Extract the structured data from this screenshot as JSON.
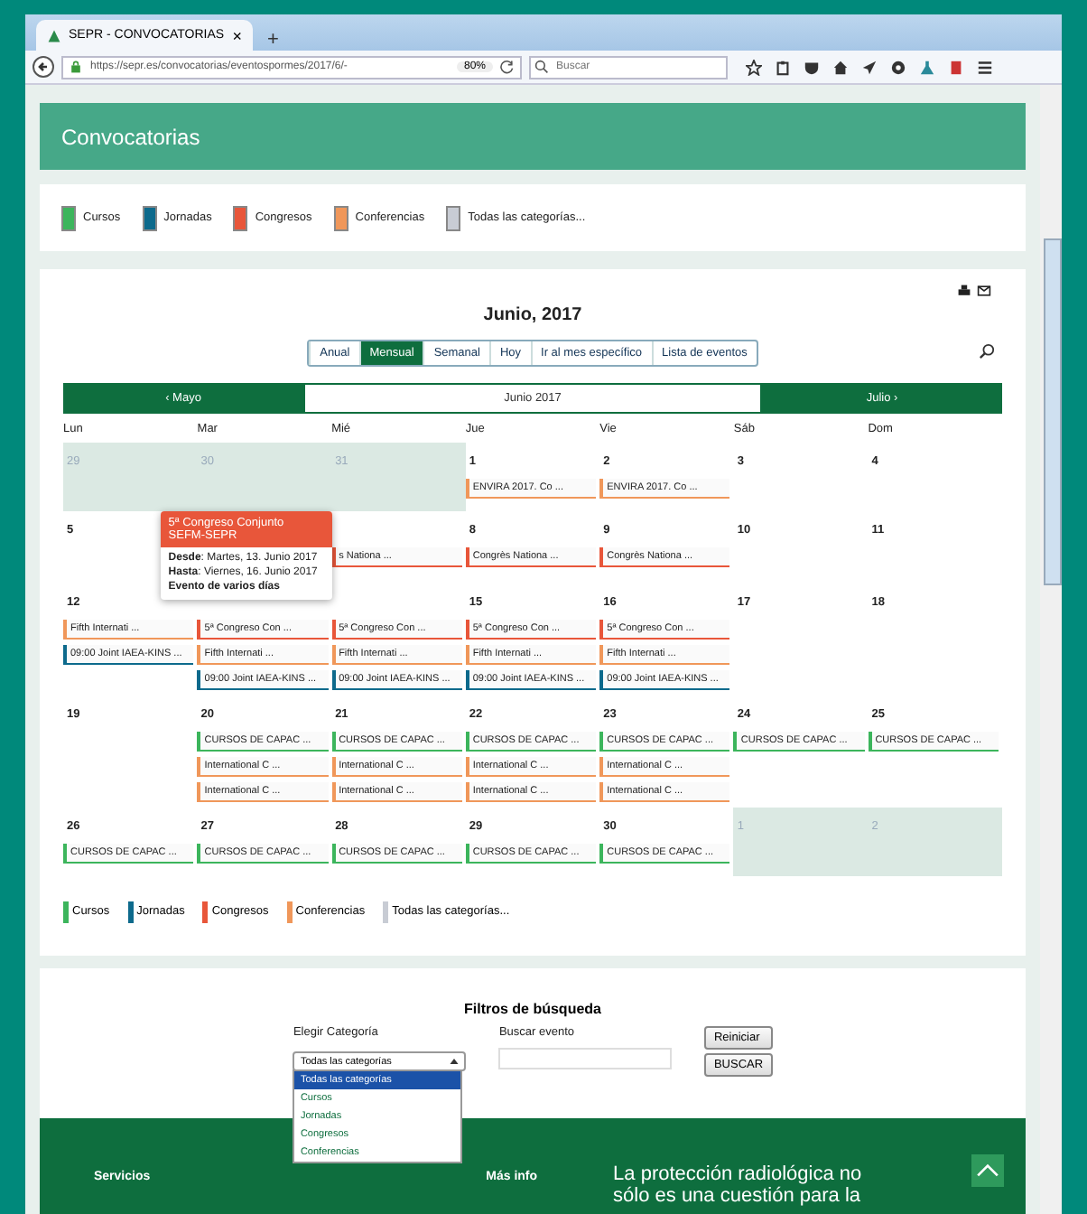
{
  "browser": {
    "tab_title": "SEPR - CONVOCATORIAS",
    "tab_close": "×",
    "new_tab": "+",
    "url": "https://sepr.es/convocatorias/eventospormes/2017/6/-",
    "zoom": "80%",
    "search_placeholder": "Buscar"
  },
  "header": {
    "title": "Convocatorias"
  },
  "legend_top": [
    {
      "label": "Cursos",
      "color": "#3cb55c"
    },
    {
      "label": "Jornadas",
      "color": "#0d6a8c"
    },
    {
      "label": "Congresos",
      "color": "#e8563a"
    },
    {
      "label": "Conferencias",
      "color": "#f0975a"
    },
    {
      "label": "Todas las categorías...",
      "color": "#c8ccd4"
    }
  ],
  "calendar": {
    "title": "Junio, 2017",
    "views": [
      {
        "label": "Anual",
        "selected": false
      },
      {
        "label": "Mensual",
        "selected": true
      },
      {
        "label": "Semanal",
        "selected": false
      },
      {
        "label": "Hoy",
        "selected": false
      },
      {
        "label": "Ir al mes específico",
        "selected": false
      },
      {
        "label": "Lista de eventos",
        "selected": false
      }
    ],
    "nav": {
      "prev": "‹ Mayo",
      "current": "Junio 2017",
      "next": "Julio ›"
    },
    "weekdays": [
      "Lun",
      "Mar",
      "Mié",
      "Jue",
      "Vie",
      "Sáb",
      "Dom"
    ],
    "weeks": [
      {
        "days": [
          {
            "day": "29",
            "other_month": true
          },
          {
            "day": "30",
            "other_month": true
          },
          {
            "day": "31",
            "other_month": true
          },
          {
            "day": "1",
            "other_month": false,
            "events": [
              {
                "text": "ENVIRA 2017. Co ...",
                "color": "#f0975a"
              }
            ]
          },
          {
            "day": "2",
            "other_month": false,
            "events": [
              {
                "text": "ENVIRA 2017. Co ...",
                "color": "#f0975a"
              }
            ]
          },
          {
            "day": "3",
            "other_month": false
          },
          {
            "day": "4",
            "other_month": false
          }
        ]
      },
      {
        "days": [
          {
            "day": "5",
            "other_month": false
          },
          {
            "popup": {
              "title": "5ª Congreso Conjunto SEFM-SEPR",
              "lines": [
                "**Desde**: Martes, 13. Junio 2017",
                "**Hasta**: Viernes, 16. Junio 2017"
              ],
              "note": "Evento de varios días"
            }
          },
          {
            "other_month": false,
            "events": [
              {
                "text": "s Nationa ...",
                "color": "#e8563a"
              }
            ]
          },
          {
            "day": "8",
            "other_month": false,
            "events": [
              {
                "text": "Congrès Nationa ...",
                "color": "#e8563a"
              }
            ]
          },
          {
            "day": "9",
            "other_month": false,
            "events": [
              {
                "text": "Congrès Nationa ...",
                "color": "#e8563a"
              }
            ]
          },
          {
            "day": "10",
            "other_month": false
          },
          {
            "day": "11",
            "other_month": false
          }
        ]
      },
      {
        "days": [
          {
            "day": "12",
            "other_month": false,
            "events": [
              {
                "text": "Fifth Internati ...",
                "color": "#f0975a"
              },
              {
                "text": "09:00 Joint IAEA-KINS ...",
                "color": "#0d6a8c"
              }
            ]
          },
          {
            "other_month": false,
            "events": [
              {
                "text": "5ª Congreso Con ...",
                "color": "#e8563a"
              },
              {
                "text": "Fifth Internati ...",
                "color": "#f0975a"
              },
              {
                "text": "09:00 Joint IAEA-KINS ...",
                "color": "#0d6a8c"
              }
            ]
          },
          {
            "other_month": false,
            "events": [
              {
                "text": "5ª Congreso Con ...",
                "color": "#e8563a"
              },
              {
                "text": "Fifth Internati ...",
                "color": "#f0975a"
              },
              {
                "text": "09:00 Joint IAEA-KINS ...",
                "color": "#0d6a8c"
              }
            ]
          },
          {
            "day": "15",
            "other_month": false,
            "events": [
              {
                "text": "5ª Congreso Con ...",
                "color": "#e8563a"
              },
              {
                "text": "Fifth Internati ...",
                "color": "#f0975a"
              },
              {
                "text": "09:00 Joint IAEA-KINS ...",
                "color": "#0d6a8c"
              }
            ]
          },
          {
            "day": "16",
            "other_month": false,
            "events": [
              {
                "text": "5ª Congreso Con ...",
                "color": "#e8563a"
              },
              {
                "text": "Fifth Internati ...",
                "color": "#f0975a"
              },
              {
                "text": "09:00 Joint IAEA-KINS ...",
                "color": "#0d6a8c"
              }
            ]
          },
          {
            "day": "17",
            "other_month": false
          },
          {
            "day": "18",
            "other_month": false
          }
        ]
      },
      {
        "days": [
          {
            "day": "19",
            "other_month": false
          },
          {
            "day": "20",
            "other_month": false,
            "events": [
              {
                "text": "CURSOS DE CAPAC ...",
                "color": "#3cb55c"
              },
              {
                "text": "International C ...",
                "color": "#f0975a"
              },
              {
                "text": "International C ...",
                "color": "#f0975a"
              }
            ]
          },
          {
            "day": "21",
            "other_month": false,
            "events": [
              {
                "text": "CURSOS DE CAPAC ...",
                "color": "#3cb55c"
              },
              {
                "text": "International C ...",
                "color": "#f0975a"
              },
              {
                "text": "International C ...",
                "color": "#f0975a"
              }
            ]
          },
          {
            "day": "22",
            "other_month": false,
            "events": [
              {
                "text": "CURSOS DE CAPAC ...",
                "color": "#3cb55c"
              },
              {
                "text": "International C ...",
                "color": "#f0975a"
              },
              {
                "text": "International C ...",
                "color": "#f0975a"
              }
            ]
          },
          {
            "day": "23",
            "other_month": false,
            "events": [
              {
                "text": "CURSOS DE CAPAC ...",
                "color": "#3cb55c"
              },
              {
                "text": "International C ...",
                "color": "#f0975a"
              },
              {
                "text": "International C ...",
                "color": "#f0975a"
              }
            ]
          },
          {
            "day": "24",
            "other_month": false,
            "events": [
              {
                "text": "CURSOS DE CAPAC ...",
                "color": "#3cb55c"
              }
            ]
          },
          {
            "day": "25",
            "other_month": false,
            "events": [
              {
                "text": "CURSOS DE CAPAC ...",
                "color": "#3cb55c"
              }
            ]
          }
        ]
      },
      {
        "days": [
          {
            "day": "26",
            "other_month": false,
            "events": [
              {
                "text": "CURSOS DE CAPAC ...",
                "color": "#3cb55c"
              }
            ]
          },
          {
            "day": "27",
            "other_month": false,
            "events": [
              {
                "text": "CURSOS DE CAPAC ...",
                "color": "#3cb55c"
              }
            ]
          },
          {
            "day": "28",
            "other_month": false,
            "events": [
              {
                "text": "CURSOS DE CAPAC ...",
                "color": "#3cb55c"
              }
            ]
          },
          {
            "day": "29",
            "other_month": false,
            "events": [
              {
                "text": "CURSOS DE CAPAC ...",
                "color": "#3cb55c"
              }
            ]
          },
          {
            "day": "30",
            "other_month": false,
            "events": [
              {
                "text": "CURSOS DE CAPAC ...",
                "color": "#3cb55c"
              }
            ]
          },
          {
            "day": "1",
            "other_month": true
          },
          {
            "day": "2",
            "other_month": true
          }
        ]
      }
    ]
  },
  "legend_bottom": [
    {
      "label": "Cursos",
      "color": "#3cb55c"
    },
    {
      "label": "Jornadas",
      "color": "#0d6a8c"
    },
    {
      "label": "Congresos",
      "color": "#e8563a"
    },
    {
      "label": "Conferencias",
      "color": "#f0975a"
    },
    {
      "label": "Todas las categorías...",
      "color": "#c8ccd4"
    }
  ],
  "filters": {
    "title": "Filtros de búsqueda",
    "category_label": "Elegir Categoría",
    "search_label": "Buscar evento",
    "select_value": "Todas las categorías",
    "options": [
      {
        "label": "Todas las categorías",
        "selected": true
      },
      {
        "label": "Cursos",
        "selected": false
      },
      {
        "label": "Jornadas",
        "selected": false
      },
      {
        "label": "Congresos",
        "selected": false
      },
      {
        "label": "Conferencias",
        "selected": false
      }
    ],
    "reset_button": "Reiniciar",
    "search_button": "BUSCAR"
  },
  "footer": {
    "links": [
      "Servicios",
      "Más info"
    ],
    "quote": "La protección radiológica no sólo es una cuestión para la"
  }
}
